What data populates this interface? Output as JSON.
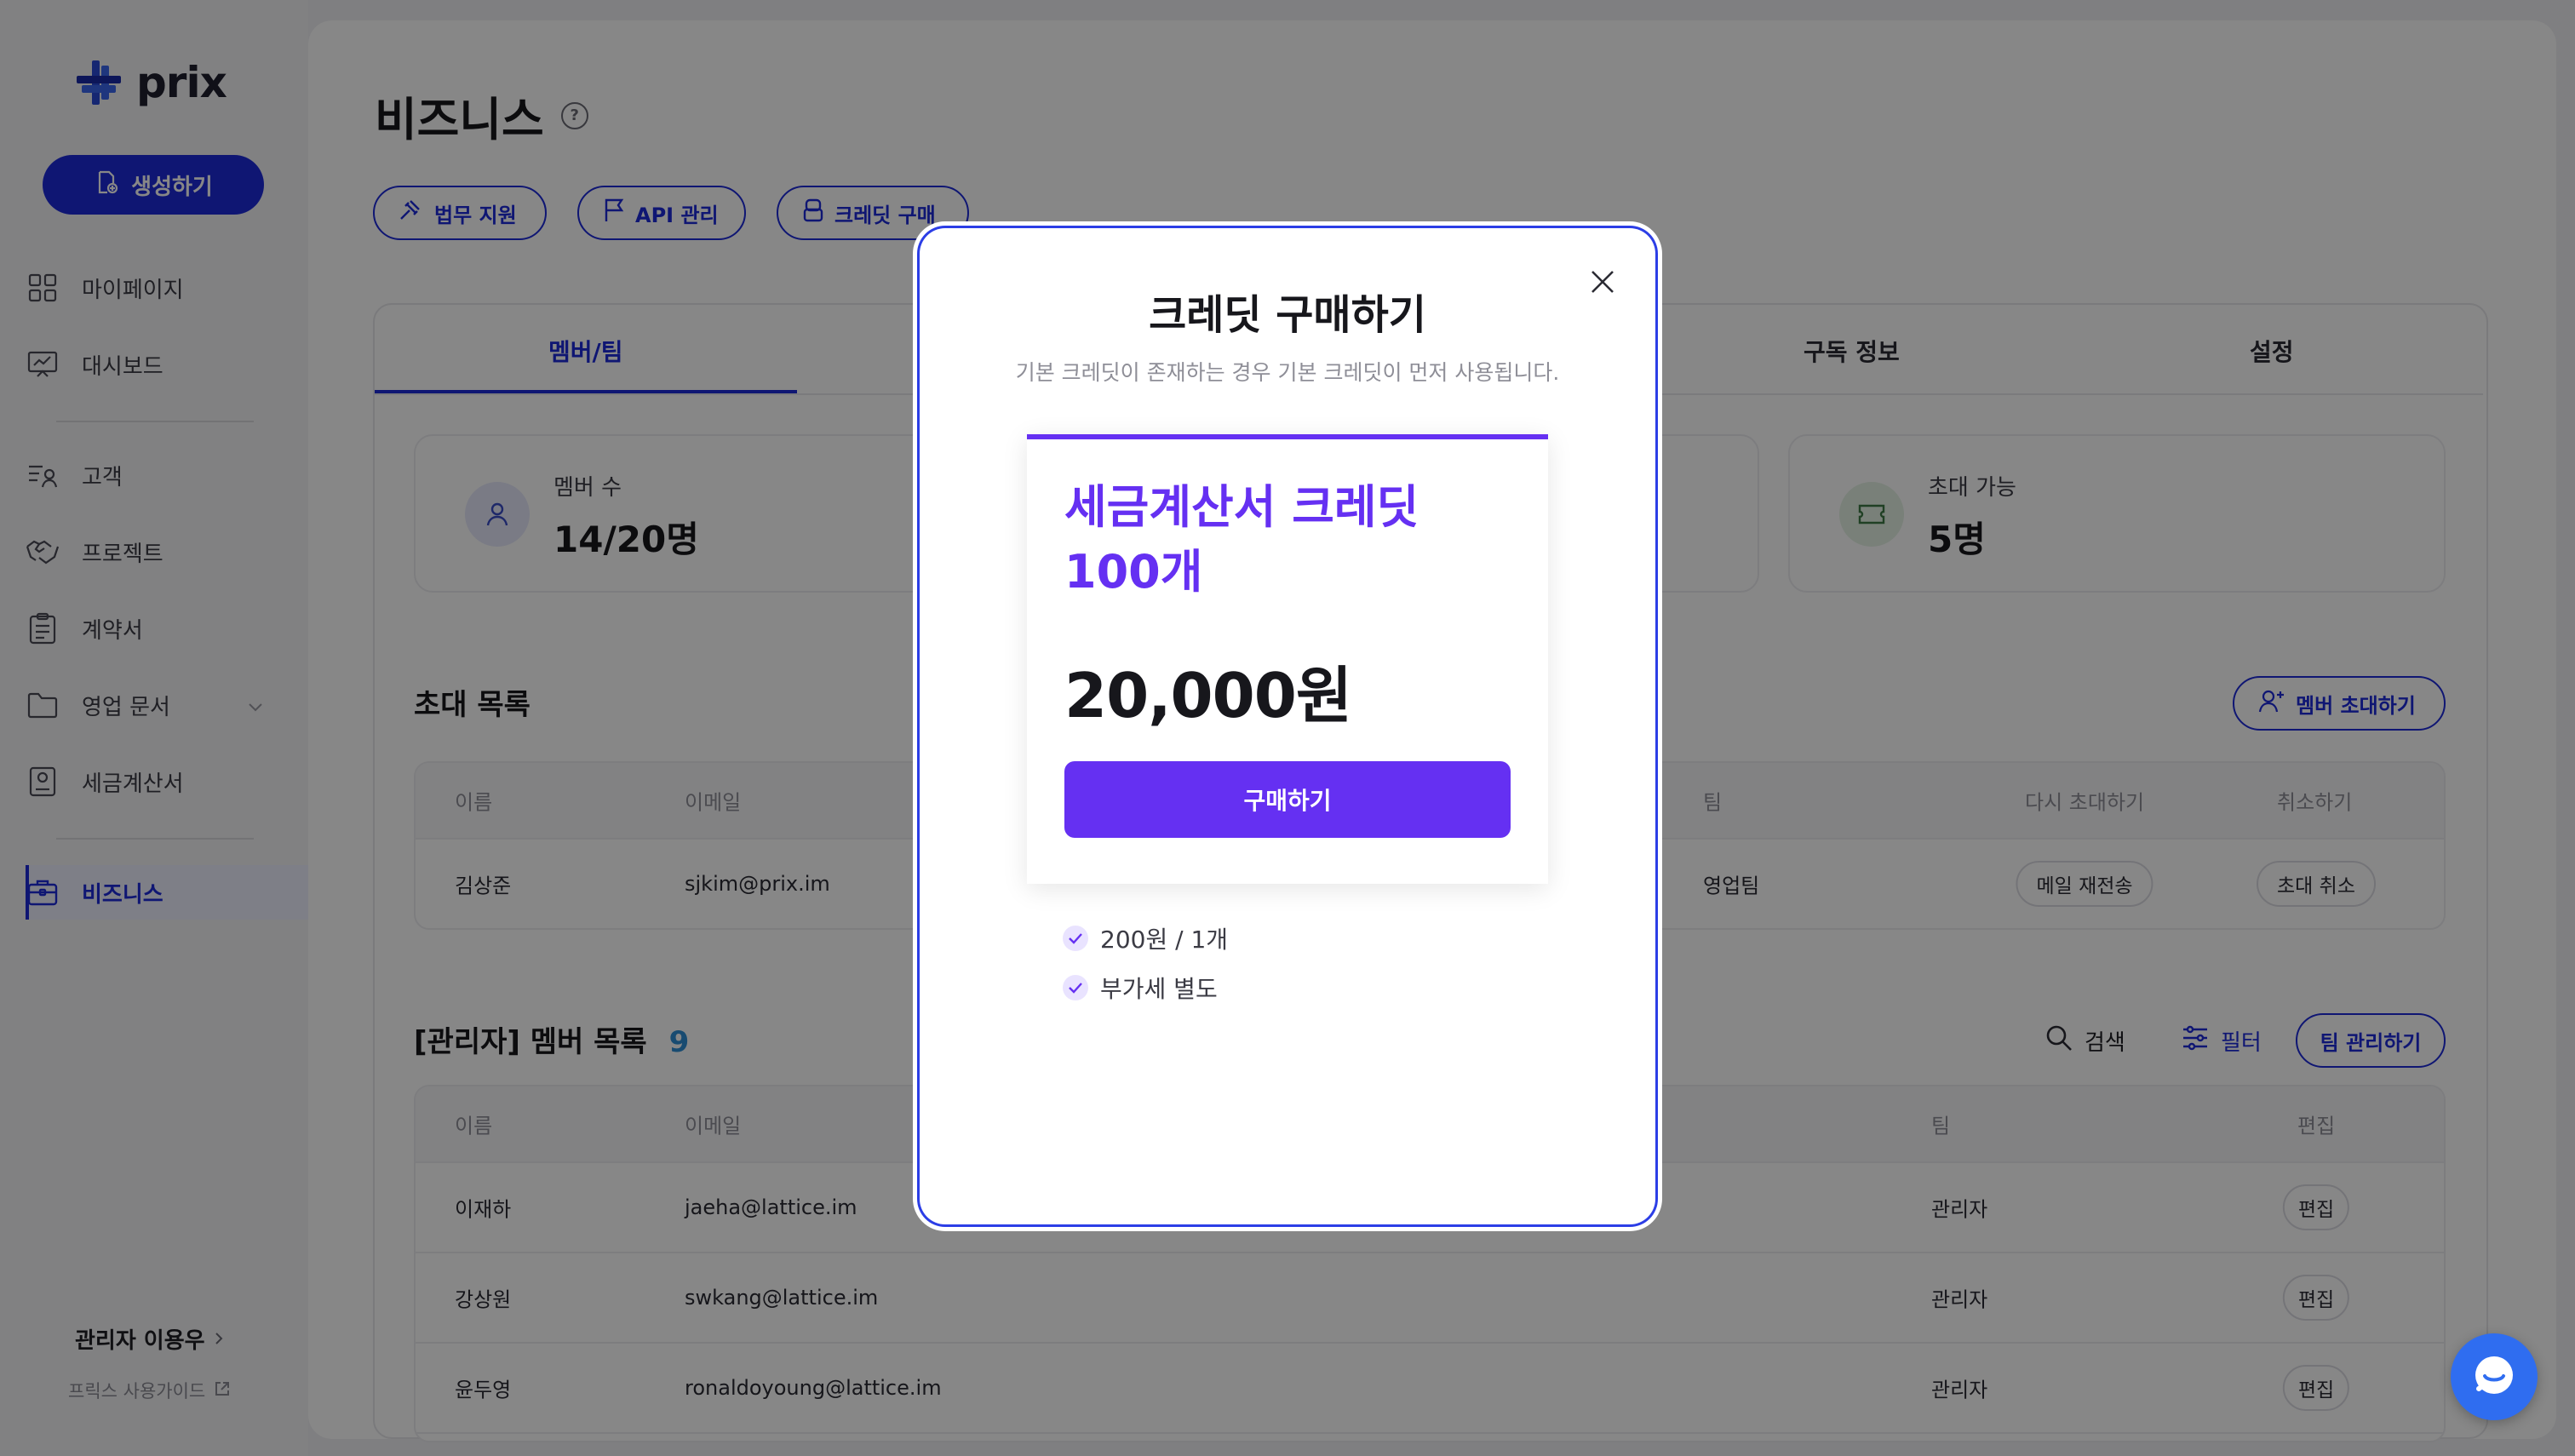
{
  "app": {
    "name": "prix"
  },
  "sidebar": {
    "create_label": "생성하기",
    "items": [
      {
        "label": "마이페이지",
        "icon": "grid-icon"
      },
      {
        "label": "대시보드",
        "icon": "chart-board-icon"
      },
      {
        "label": "고객",
        "icon": "user-list-icon"
      },
      {
        "label": "프로젝트",
        "icon": "handshake-icon"
      },
      {
        "label": "계약서",
        "icon": "clipboard-icon"
      },
      {
        "label": "영업 문서",
        "icon": "folder-icon"
      },
      {
        "label": "세금계산서",
        "icon": "receipt-icon"
      },
      {
        "label": "비즈니스",
        "icon": "briefcase-icon"
      }
    ],
    "user_label": "관리자 이용우",
    "guide_label": "프릭스 사용가이드"
  },
  "page": {
    "title": "비즈니스",
    "chips": [
      "법무 지원",
      "API 관리",
      "크레딧 구매"
    ],
    "tabs": [
      "멤버/팀",
      "구독 정보",
      "설정"
    ],
    "stats": [
      {
        "label": "멤버 수",
        "value": "14/20명"
      },
      {
        "label": "초대 가능",
        "value": "5명"
      }
    ]
  },
  "invites": {
    "title": "초대 목록",
    "invite_button": "멤버 초대하기",
    "columns": [
      "이름",
      "이메일",
      "팀",
      "다시 초대하기",
      "취소하기"
    ],
    "rows": [
      {
        "name": "김상준",
        "email": "sjkim@prix.im",
        "team": "영업팀",
        "resend": "메일 재전송",
        "cancel": "초대 취소"
      }
    ]
  },
  "members": {
    "title": "[관리자] 멤버 목록",
    "count": "9",
    "search_label": "검색",
    "filter_label": "필터",
    "manage_button": "팀 관리하기",
    "columns": [
      "이름",
      "이메일",
      "팀",
      "편집"
    ],
    "rows": [
      {
        "name": "이재하",
        "email": "jaeha@lattice.im",
        "team": "관리자",
        "edit": "편집"
      },
      {
        "name": "강상원",
        "email": "swkang@lattice.im",
        "team": "관리자",
        "edit": "편집"
      },
      {
        "name": "윤두영",
        "email": "ronaldoyoung@lattice.im",
        "team": "관리자",
        "edit": "편집"
      }
    ]
  },
  "modal": {
    "title": "크레딧 구매하기",
    "subtitle": "기본 크레딧이 존재하는 경우 기본 크레딧이 먼저 사용됩니다.",
    "product": {
      "name": "세금계산서 크레딧 100개",
      "price": "20,000원",
      "buy_label": "구매하기"
    },
    "features": [
      "200원 / 1개",
      "부가세 별도"
    ]
  },
  "colors": {
    "brand": "#1d2bd9",
    "accent": "#6530f2",
    "chat": "#2f6df0"
  }
}
